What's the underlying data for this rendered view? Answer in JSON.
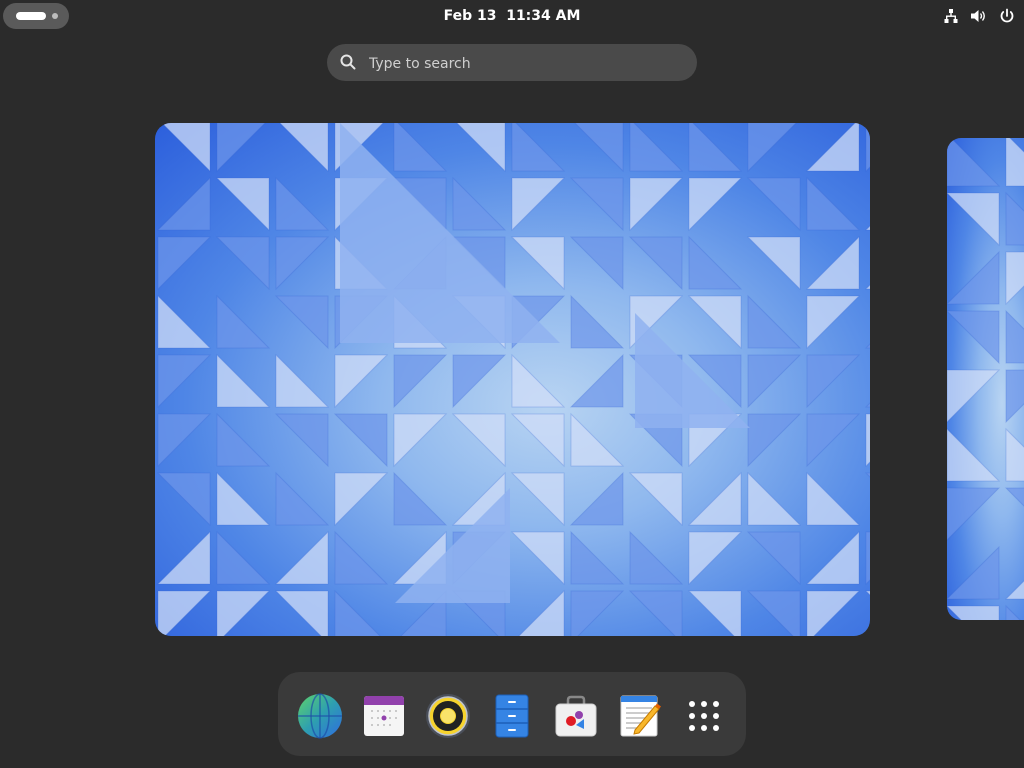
{
  "topbar": {
    "activities_label": "Activities",
    "date": "Feb 13",
    "time": "11:34 AM",
    "tray_icons": [
      "network-wired-icon",
      "volume-icon",
      "power-icon"
    ]
  },
  "search": {
    "placeholder": "Type to search"
  },
  "workspaces": [
    {
      "name": "workspace-1",
      "wallpaper": "blue-triangles"
    },
    {
      "name": "workspace-2",
      "wallpaper": "blue-triangles"
    }
  ],
  "dash": {
    "apps": [
      {
        "name": "Web Browser",
        "icon": "globe-icon"
      },
      {
        "name": "Calendar",
        "icon": "calendar-icon"
      },
      {
        "name": "Rhythmbox",
        "icon": "music-speaker-icon"
      },
      {
        "name": "Files",
        "icon": "file-cabinet-icon"
      },
      {
        "name": "Software",
        "icon": "software-bag-icon"
      },
      {
        "name": "Text Editor",
        "icon": "text-editor-icon"
      },
      {
        "name": "Show Apps",
        "icon": "app-grid-icon"
      }
    ]
  },
  "colors": {
    "background": "#2b2b2b",
    "panel": "#3a3a3a",
    "search_bg": "#4a4a4a",
    "wallpaper_blue": "#3b6fe0",
    "wallpaper_light": "#b8d4f2"
  }
}
